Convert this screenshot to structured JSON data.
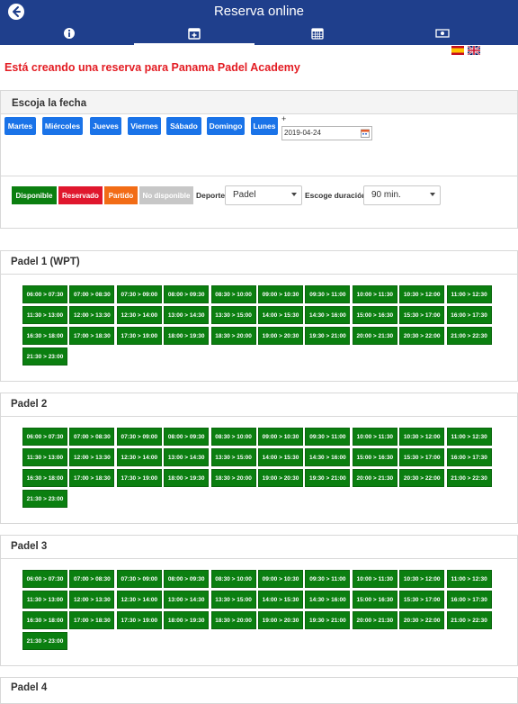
{
  "app": {
    "title": "Reserva online",
    "back_icon": "back-arrow-icon",
    "tabs": [
      {
        "icon": "info-icon"
      },
      {
        "icon": "calendar-plus-icon",
        "active": true
      },
      {
        "icon": "calendar-grid-icon"
      },
      {
        "icon": "money-icon"
      }
    ],
    "languages": [
      "spanish-flag-icon",
      "uk-flag-icon"
    ]
  },
  "headline": "Está creando una reserva para Panama Padel Academy",
  "date_section": {
    "title": "Escoja la fecha",
    "days": [
      "Martes",
      "Miércoles",
      "Jueves",
      "Viernes",
      "Sábado",
      "Domingo",
      "Lunes"
    ],
    "plus_label": "+",
    "date_value": "2019-04-24"
  },
  "filters": {
    "legend": [
      {
        "label": "Disponible",
        "color": "#0b7f10"
      },
      {
        "label": "Reservado",
        "color": "#e0172d"
      },
      {
        "label": "Partido",
        "color": "#f26c16"
      },
      {
        "label": "No disponible",
        "color": "#c7c7c7"
      }
    ],
    "sport_label": "Deporte",
    "sport_value": "Padel",
    "duration_label": "Escoge duración",
    "duration_value": "90 min."
  },
  "courts": [
    {
      "name": "Padel 1 (WPT)",
      "slots": [
        "06:00 > 07:30",
        "07:00 > 08:30",
        "07:30 > 09:00",
        "08:00 > 09:30",
        "08:30 > 10:00",
        "09:00 > 10:30",
        "09:30 > 11:00",
        "10:00 > 11:30",
        "10:30 > 12:00",
        "11:00 > 12:30",
        "11:30 > 13:00",
        "12:00 > 13:30",
        "12:30 > 14:00",
        "13:00 > 14:30",
        "13:30 > 15:00",
        "14:00 > 15:30",
        "14:30 > 16:00",
        "15:00 > 16:30",
        "15:30 > 17:00",
        "16:00 > 17:30",
        "16:30 > 18:00",
        "17:00 > 18:30",
        "17:30 > 19:00",
        "18:00 > 19:30",
        "18:30 > 20:00",
        "19:00 > 20:30",
        "19:30 > 21:00",
        "20:00 > 21:30",
        "20:30 > 22:00",
        "21:00 > 22:30",
        "21:30 > 23:00"
      ]
    },
    {
      "name": "Padel 2",
      "slots": [
        "06:00 > 07:30",
        "07:00 > 08:30",
        "07:30 > 09:00",
        "08:00 > 09:30",
        "08:30 > 10:00",
        "09:00 > 10:30",
        "09:30 > 11:00",
        "10:00 > 11:30",
        "10:30 > 12:00",
        "11:00 > 12:30",
        "11:30 > 13:00",
        "12:00 > 13:30",
        "12:30 > 14:00",
        "13:00 > 14:30",
        "13:30 > 15:00",
        "14:00 > 15:30",
        "14:30 > 16:00",
        "15:00 > 16:30",
        "15:30 > 17:00",
        "16:00 > 17:30",
        "16:30 > 18:00",
        "17:00 > 18:30",
        "17:30 > 19:00",
        "18:00 > 19:30",
        "18:30 > 20:00",
        "19:00 > 20:30",
        "19:30 > 21:00",
        "20:00 > 21:30",
        "20:30 > 22:00",
        "21:00 > 22:30",
        "21:30 > 23:00"
      ]
    },
    {
      "name": "Padel 3",
      "slots": [
        "06:00 > 07:30",
        "07:00 > 08:30",
        "07:30 > 09:00",
        "08:00 > 09:30",
        "08:30 > 10:00",
        "09:00 > 10:30",
        "09:30 > 11:00",
        "10:00 > 11:30",
        "10:30 > 12:00",
        "11:00 > 12:30",
        "11:30 > 13:00",
        "12:00 > 13:30",
        "12:30 > 14:00",
        "13:00 > 14:30",
        "13:30 > 15:00",
        "14:00 > 15:30",
        "14:30 > 16:00",
        "15:00 > 16:30",
        "15:30 > 17:00",
        "16:00 > 17:30",
        "16:30 > 18:00",
        "17:00 > 18:30",
        "17:30 > 19:00",
        "18:00 > 19:30",
        "18:30 > 20:00",
        "19:00 > 20:30",
        "19:30 > 21:00",
        "20:00 > 21:30",
        "20:30 > 22:00",
        "21:00 > 22:30",
        "21:30 > 23:00"
      ]
    },
    {
      "name": "Padel 4",
      "slots": []
    }
  ]
}
